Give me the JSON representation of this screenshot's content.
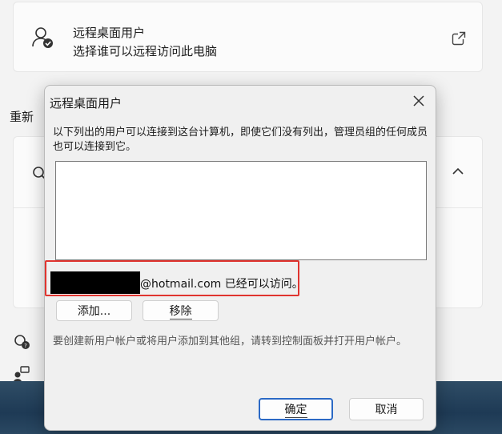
{
  "background": {
    "card": {
      "title": "远程桌面用户",
      "subtitle": "选择谁可以远程访问此电脑",
      "icon": "user-check-icon",
      "action_icon": "open-external-icon"
    },
    "section_label": "重新",
    "panel_icon": "search-person-icon",
    "panel_chevron": "chevron-up-icon"
  },
  "dialog": {
    "title": "远程桌面用户",
    "close_icon": "close-icon",
    "description": "以下列出的用户可以连接到这台计算机，即使它们没有列出，管理员组的任何成员也可以连接到它。",
    "users_list": [],
    "status_text": "@hotmail.com 已经可以访问。",
    "add_button": "添加...",
    "remove_button": "移除",
    "hint": "要创建新用户帐户或将用户添加到其他组，请转到控制面板并打开用户帐户。",
    "ok_button": "确定",
    "cancel_button": "取消"
  },
  "colors": {
    "highlight_border": "#e0342f",
    "default_button_border": "#2b69c5"
  }
}
